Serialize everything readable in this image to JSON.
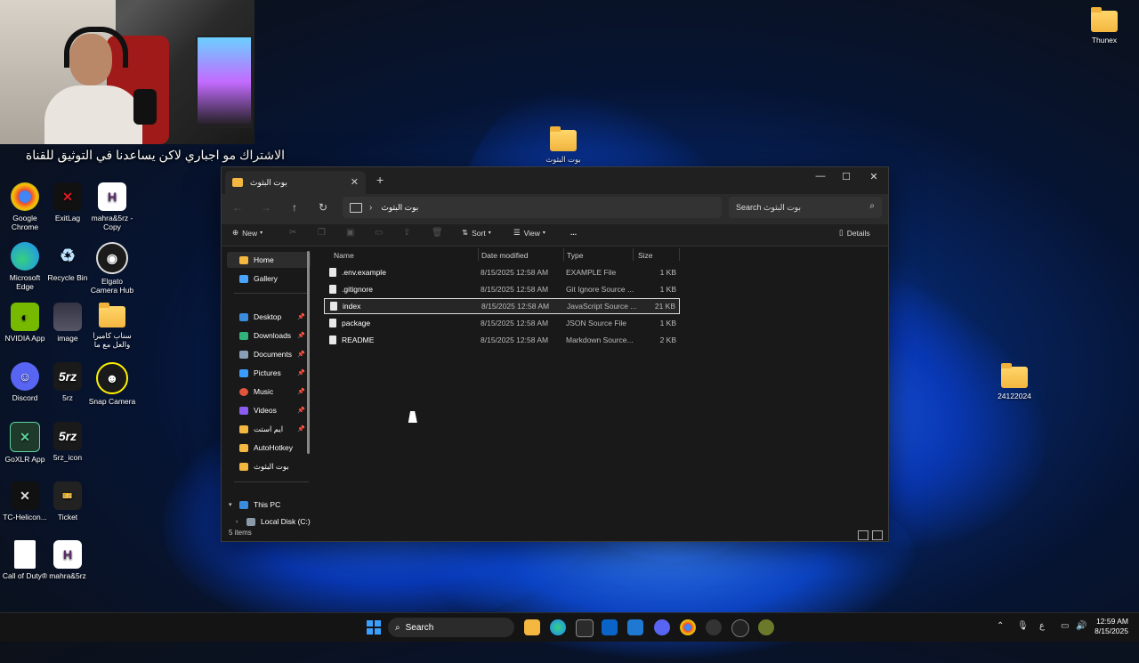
{
  "webcam": {
    "caption": "الاشتراك مو اجباري لاكن يساعدنا في التوثيق للقناة"
  },
  "desktop_icons_left": [
    {
      "label": "Google Chrome",
      "icon": "chrome-icon",
      "color": "#ea4335"
    },
    {
      "label": "ExitLag",
      "icon": "exitlag-icon",
      "color": "#c0101a"
    },
    {
      "label": "mahra&5rz - Copy",
      "icon": "h-letter-icon",
      "color": "#ffffff"
    },
    {
      "label": "Microsoft Edge",
      "icon": "edge-icon",
      "color": "#1fa3ff"
    },
    {
      "label": "Recycle Bin",
      "icon": "recycle-bin-icon",
      "color": "#9ad0ff"
    },
    {
      "label": "Elgato Camera Hub",
      "icon": "elgato-icon",
      "color": "#222222"
    },
    {
      "label": "NVIDIA App",
      "icon": "nvidia-icon",
      "color": "#76b900"
    },
    {
      "label": "image",
      "icon": "image-file-icon",
      "color": "#445"
    },
    {
      "label": "سناب كاميرا والعل مع ما",
      "icon": "folder-icon",
      "color": "#f4b740"
    },
    {
      "label": "Discord",
      "icon": "discord-icon",
      "color": "#5865f2"
    },
    {
      "label": "5rz",
      "icon": "5rz-logo-icon",
      "color": "#222"
    },
    {
      "label": "Snap Camera",
      "icon": "snap-camera-icon",
      "color": "#1a1a1a"
    },
    {
      "label": "GoXLR App",
      "icon": "goxlr-icon",
      "color": "#1f3a2a"
    },
    {
      "label": "5rz_icon",
      "icon": "5rz-logo-icon",
      "color": "#222"
    },
    {
      "label": "TC-Helicon...",
      "icon": "tc-helicon-icon",
      "color": "#111"
    },
    {
      "label": "Ticket",
      "icon": "ticket-icon",
      "color": "#222"
    },
    {
      "label": "Call of Duty®",
      "icon": "document-icon",
      "color": "#ffffff"
    },
    {
      "label": "mahra&5rz",
      "icon": "h-letter-icon",
      "color": "#ffffff"
    }
  ],
  "desktop_icons_right": [
    {
      "label": "Thunex",
      "icon": "folder-icon"
    },
    {
      "label": "بوت البثوث",
      "icon": "folder-icon"
    },
    {
      "label": "24122024",
      "icon": "folder-icon"
    }
  ],
  "explorer": {
    "tab_title": "بوت البثوث",
    "breadcrumb": "بوت البثوث",
    "search_placeholder": "Search بوت البثوث",
    "toolbar": {
      "new": "New",
      "sort": "Sort",
      "view": "View",
      "more": "...",
      "details": "Details"
    },
    "sidebar": [
      {
        "label": "Home",
        "icon": "home-icon",
        "active": true,
        "pinned": false
      },
      {
        "label": "Gallery",
        "icon": "gallery-icon",
        "pinned": false
      },
      {
        "label": "Desktop",
        "icon": "desktop-icon",
        "pinned": true
      },
      {
        "label": "Downloads",
        "icon": "downloads-icon",
        "pinned": true
      },
      {
        "label": "Documents",
        "icon": "documents-icon",
        "pinned": true
      },
      {
        "label": "Pictures",
        "icon": "pictures-icon",
        "pinned": true
      },
      {
        "label": "Music",
        "icon": "music-icon",
        "pinned": true
      },
      {
        "label": "Videos",
        "icon": "videos-icon",
        "pinned": true
      },
      {
        "label": "ايم استت",
        "icon": "folder-icon",
        "pinned": true
      },
      {
        "label": "AutoHotkey",
        "icon": "folder-icon",
        "pinned": false
      },
      {
        "label": "بوت البثوث",
        "icon": "folder-icon",
        "pinned": false
      },
      {
        "label": "This PC",
        "icon": "this-pc-icon",
        "pinned": false
      },
      {
        "label": "Local Disk (C:)",
        "icon": "disk-icon",
        "pinned": false
      }
    ],
    "columns": [
      "Name",
      "Date modified",
      "Type",
      "Size"
    ],
    "files": [
      {
        "name": ".env.example",
        "date": "8/15/2025 12:58 AM",
        "type": "EXAMPLE File",
        "size": "1 KB"
      },
      {
        "name": ".gitignore",
        "date": "8/15/2025 12:58 AM",
        "type": "Git Ignore Source ...",
        "size": "1 KB"
      },
      {
        "name": "index",
        "date": "8/15/2025 12:58 AM",
        "type": "JavaScript Source ...",
        "size": "21 KB",
        "selected": true
      },
      {
        "name": "package",
        "date": "8/15/2025 12:58 AM",
        "type": "JSON Source File",
        "size": "1 KB"
      },
      {
        "name": "README",
        "date": "8/15/2025 12:58 AM",
        "type": "Markdown Source...",
        "size": "2 KB"
      }
    ],
    "status": "5 items"
  },
  "taskbar": {
    "search_label": "Search",
    "apps": [
      "file-explorer-icon",
      "edge-icon",
      "store-icon",
      "outlook-icon",
      "vscode-icon",
      "discord-icon",
      "chrome-icon",
      "github-icon",
      "xbox-icon",
      "app-icon"
    ],
    "tray_lang": "ع",
    "time": "12:59 AM",
    "date": "8/15/2025"
  }
}
